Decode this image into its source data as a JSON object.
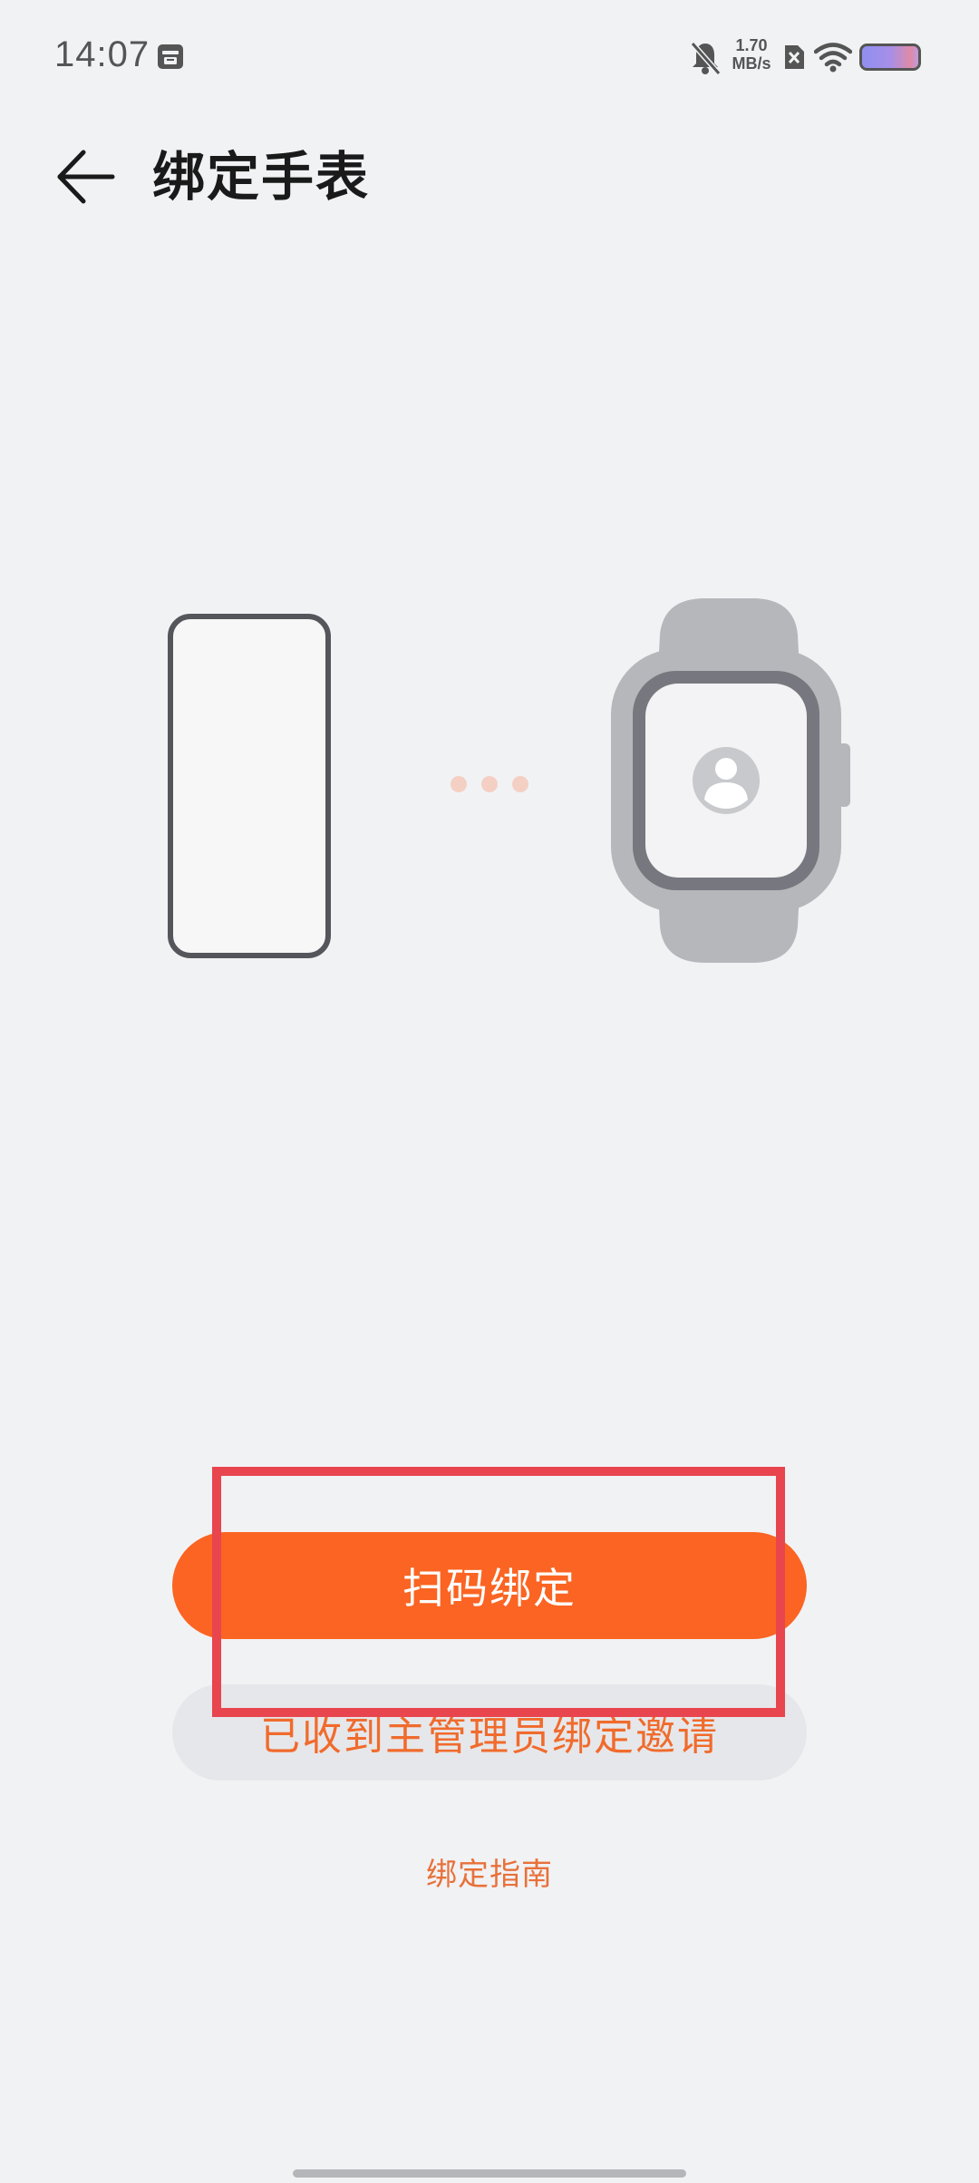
{
  "status_bar": {
    "time": "14:07",
    "net_speed_value": "1.70",
    "net_speed_unit": "MB/s",
    "icons": [
      "calendar-app-icon",
      "bell-off-icon",
      "sim-disabled-icon",
      "wifi-icon",
      "battery-icon"
    ]
  },
  "header": {
    "back_icon": "arrow-left-icon",
    "title": "绑定手表"
  },
  "illustration": {
    "left_device": "phone-icon",
    "connector": "dots-icon",
    "right_device": "watch-icon",
    "watch_face_icon": "user-avatar-icon"
  },
  "actions": {
    "scan_bind_label": "扫码绑定",
    "invite_label": "已收到主管理员绑定邀请",
    "guide_label": "绑定指南"
  },
  "colors": {
    "accent": "#fb6422",
    "accent_text": "#f06b2c",
    "background": "#f1f2f4",
    "highlight": "#e8454f"
  }
}
